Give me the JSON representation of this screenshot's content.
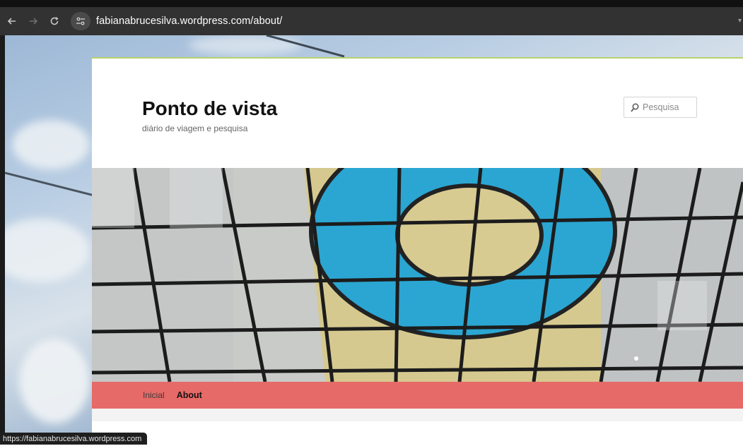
{
  "browser": {
    "url": "fabianabrucesilva.wordpress.com/about/",
    "back_icon": "arrow-left-icon",
    "forward_icon": "arrow-right-icon",
    "reload_icon": "reload-icon",
    "site_info_icon": "tune-icon"
  },
  "site": {
    "title": "Ponto de vista",
    "description": "diário de viagem e pesquisa",
    "search_placeholder": "Pesquisa"
  },
  "nav": {
    "items": [
      {
        "label": "Inicial"
      },
      {
        "label": "About"
      }
    ]
  },
  "status": {
    "link": "https://fabianabrucesilva.wordpress.com"
  },
  "colors": {
    "nav_bar": "#e66a67",
    "header_accent": "#b7d36d",
    "glass_blue": "#2ba6d2",
    "glass_yellow": "#d6c98f"
  }
}
